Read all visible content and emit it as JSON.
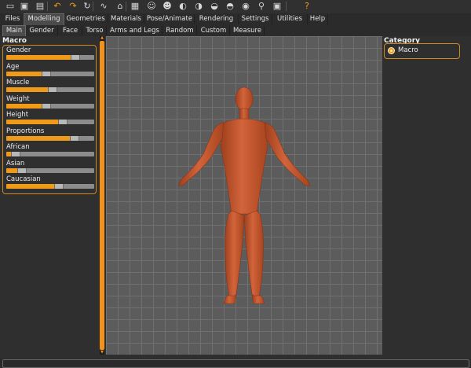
{
  "toolbar": {
    "icons": [
      "new-file",
      "save",
      "export",
      "undo",
      "redo",
      "reset",
      "smooth",
      "wireframe",
      "background",
      "front-view",
      "back-view",
      "left-view",
      "right-view",
      "top-view",
      "bottom-view",
      "reset-camera",
      "pose",
      "screenshot",
      "help"
    ],
    "glyphs": [
      "▭",
      "▣",
      "▤",
      "↶",
      "↷",
      "↻",
      "∿",
      "⌂",
      "▦",
      "☺",
      "☻",
      "◐",
      "◑",
      "◒",
      "◓",
      "◉",
      "⚲",
      "▣",
      "?"
    ]
  },
  "main_tabs": [
    "Files",
    "Modelling",
    "Geometries",
    "Materials",
    "Pose/Animate",
    "Rendering",
    "Settings",
    "Utilities",
    "Help"
  ],
  "active_main_tab": "Modelling",
  "sub_tabs": [
    "Main",
    "Gender",
    "Face",
    "Torso",
    "Arms and Legs",
    "Random",
    "Custom",
    "Measure"
  ],
  "active_sub_tab": "Main",
  "left_panel": {
    "title": "Macro",
    "sliders": [
      {
        "label": "Gender",
        "value": 0.78
      },
      {
        "label": "Age",
        "value": 0.45
      },
      {
        "label": "Muscle",
        "value": 0.52
      },
      {
        "label": "Weight",
        "value": 0.45
      },
      {
        "label": "Height",
        "value": 0.63
      },
      {
        "label": "Proportions",
        "value": 0.77
      },
      {
        "label": "African",
        "value": 0.1
      },
      {
        "label": "Asian",
        "value": 0.17
      },
      {
        "label": "Caucasian",
        "value": 0.59
      }
    ]
  },
  "right_panel": {
    "title": "Category",
    "option": "Macro"
  },
  "colors": {
    "accent": "#f09a1a",
    "model_skin": "#c8592e",
    "viewport_bg": "#5c5c5c"
  }
}
